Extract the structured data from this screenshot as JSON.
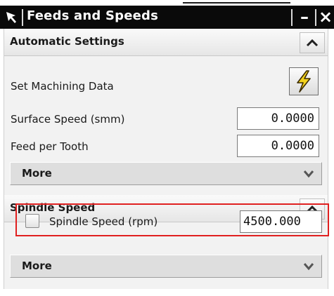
{
  "window": {
    "title": "Feeds and Speeds",
    "minimize_glyph": "–",
    "close_glyph": "×",
    "icon": "cursor-arrow-icon"
  },
  "automatic_settings": {
    "header": "Automatic Settings",
    "collapse_icon": "chevron-up-icon",
    "set_machining_data_label": "Set Machining Data",
    "set_machining_data_icon": "lightning-icon",
    "surface_speed_label": "Surface Speed (smm)",
    "surface_speed_value": "0.0000",
    "feed_per_tooth_label": "Feed per Tooth",
    "feed_per_tooth_value": "0.0000",
    "more_label": "More",
    "more_icon": "chevron-down-icon"
  },
  "spindle_speed": {
    "header": "Spindle Speed",
    "collapse_icon": "chevron-up-icon",
    "checkbox_label": "Spindle Speed (rpm)",
    "checkbox_checked": false,
    "rpm_value": "4500.000",
    "more_label": "More",
    "more_icon": "chevron-down-icon"
  },
  "colors": {
    "titlebar_bg": "#0a0a0a",
    "panel_bg": "#f2f2f2",
    "highlight_border": "#e02020",
    "lightning_fill": "#f2d21e"
  }
}
